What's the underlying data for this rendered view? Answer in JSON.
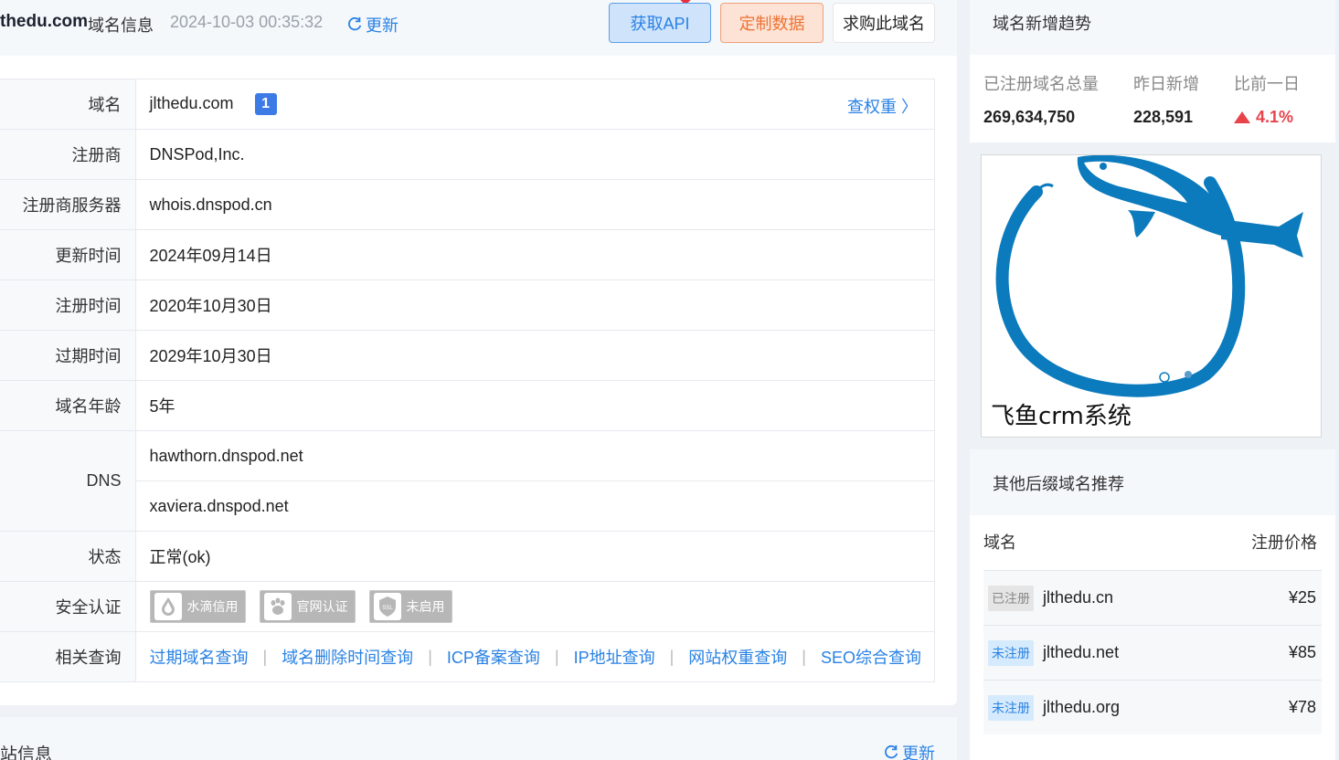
{
  "header": {
    "domain": "thedu.com",
    "label": "域名信息",
    "time": "2024-10-03 00:35:32",
    "refresh": "更新",
    "btn_api": "获取API",
    "btn_custom": "定制数据",
    "btn_buy": "求购此域名"
  },
  "info": {
    "domain_key": "域名",
    "domain_val": "jlthedu.com",
    "rank": "1",
    "check_weight": "查权重 〉",
    "registrar_key": "注册商",
    "registrar_val": "DNSPod,Inc.",
    "server_key": "注册商服务器",
    "server_val": "whois.dnspod.cn",
    "updated_key": "更新时间",
    "updated_val": "2024年09月14日",
    "created_key": "注册时间",
    "created_val": "2020年10月30日",
    "expires_key": "过期时间",
    "expires_val": "2029年10月30日",
    "age_key": "域名年龄",
    "age_val": "5年",
    "dns_key": "DNS",
    "dns_1": "hawthorn.dnspod.net",
    "dns_2": "xaviera.dnspod.net",
    "status_key": "状态",
    "status_val": "正常(ok)",
    "security_key": "安全认证",
    "security": [
      "水滴信用",
      "官网认证",
      "未启用"
    ],
    "related_key": "相关查询",
    "related": [
      "过期域名查询",
      "域名删除时间查询",
      "ICP备案查询",
      "IP地址查询",
      "网站权重查询",
      "SEO综合查询"
    ]
  },
  "site": {
    "title": "站信息",
    "refresh": "更新"
  },
  "trend": {
    "title": "域名新增趋势",
    "total_label": "已注册域名总量",
    "total_value": "269,634,750",
    "yesterday_label": "昨日新增",
    "yesterday_value": "228,591",
    "change_label": "比前一日",
    "change_value": "4.1%"
  },
  "ad": {
    "caption": "飞鱼crm系统"
  },
  "recommend": {
    "title": "其他后缀域名推荐",
    "col_domain": "域名",
    "col_price": "注册价格",
    "rows": [
      {
        "tag": "已注册",
        "name": "jlthedu.cn",
        "price": "¥25"
      },
      {
        "tag": "未注册",
        "name": "jlthedu.net",
        "price": "¥85"
      },
      {
        "tag": "未注册",
        "name": "jlthedu.org",
        "price": "¥78"
      }
    ]
  },
  "colors": {
    "link": "#2a82e4",
    "badge": "#3c7be6",
    "up": "#e8434a"
  }
}
